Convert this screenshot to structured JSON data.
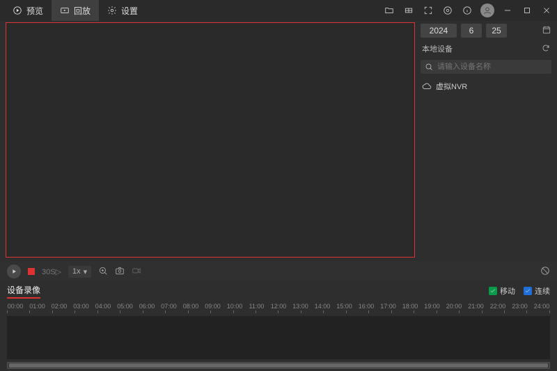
{
  "tabs": {
    "preview": "预览",
    "playback": "回放",
    "settings": "设置"
  },
  "date": {
    "year": "2024",
    "month": "6",
    "day": "25"
  },
  "sidebar": {
    "local_devices": "本地设备",
    "search_placeholder": "请输入设备名称",
    "device_name": "虚拟NVR"
  },
  "controls": {
    "thirty_s": "30S",
    "speed": "1x"
  },
  "record_type": {
    "tab": "设备录像",
    "check_motion": "移动",
    "check_continuous": "连续"
  },
  "timeline_hours": [
    "00:00",
    "01:00",
    "02:00",
    "03:00",
    "04:00",
    "05:00",
    "06:00",
    "07:00",
    "08:00",
    "09:00",
    "10:00",
    "11:00",
    "12:00",
    "13:00",
    "14:00",
    "15:00",
    "16:00",
    "17:00",
    "18:00",
    "19:00",
    "20:00",
    "21:00",
    "22:00",
    "23:00",
    "24:00"
  ]
}
